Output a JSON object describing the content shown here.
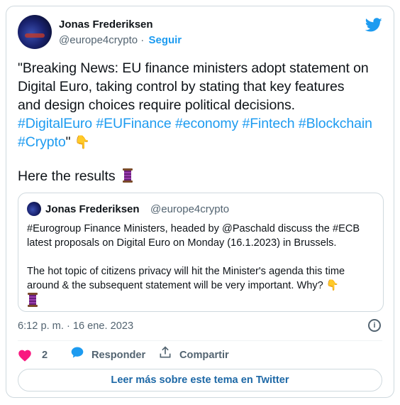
{
  "author": {
    "name": "Jonas Frederiksen",
    "handle": "@europe4crypto",
    "follow_label": "Seguir"
  },
  "tweet": {
    "line1": "\"Breaking News: EU finance ministers adopt statement on",
    "line2": "Digital Euro, taking control by stating that key features",
    "line3": "and design choices require political decisions.",
    "tags_line1": [
      "#DigitalEuro",
      "#EUFinance",
      "#economy",
      "#Fintech",
      "#Blockchain"
    ],
    "tags_line2_tag": "#Crypto",
    "tags_line2_after": "\"",
    "emoji_point": "👇",
    "results": "Here the results"
  },
  "quoted": {
    "name": "Jonas Frederiksen",
    "handle": "@europe4crypto",
    "para1_line1": "#Eurogroup Finance Ministers, headed by @Paschald discuss the #ECB",
    "para1_line2": "latest proposals on Digital Euro  on Monday (16.1.2023) in Brussels.",
    "para2_line1": "The hot topic of citizens privacy will hit the Minister's agenda this time",
    "para2_line2": "around & the subsequent statement will be very important. Why?",
    "emoji_point": "👇"
  },
  "timestamp": "6:12 p. m. · 16 ene. 2023",
  "actions": {
    "likes": "2",
    "reply_label": "Responder",
    "share_label": "Compartir"
  },
  "read_more": "Leer más sobre este tema en Twitter",
  "colors": {
    "accent": "#1d9bf0",
    "like": "#f91880",
    "text_secondary": "#536471",
    "border": "#cfd9de"
  }
}
